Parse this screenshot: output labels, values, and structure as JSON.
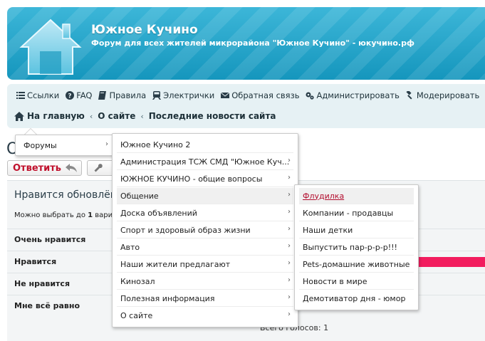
{
  "header": {
    "title": "Южное Кучино",
    "subtitle": "Форум для всех жителей микрорайона \"Южное Кучино\" - юкучино.рф"
  },
  "toplinks": [
    {
      "label": "Ссылки",
      "icon": "list-icon"
    },
    {
      "label": "FAQ",
      "icon": "question-circle-icon"
    },
    {
      "label": "Правила",
      "icon": "book-icon"
    },
    {
      "label": "Электрички",
      "icon": "train-icon"
    },
    {
      "label": "Обратная связь",
      "icon": "envelope-icon"
    },
    {
      "label": "Администрировать",
      "icon": "gears-icon"
    },
    {
      "label": "Модерировать",
      "icon": "gavel-icon"
    }
  ],
  "breadcrumb": {
    "home": "На главную",
    "items": [
      "О сайте",
      "Последние новости сайта"
    ]
  },
  "page": {
    "title_fragment": "О",
    "reply_label": "Ответить",
    "poll_title": "Нравится обновлён",
    "poll_hint_prefix": "Можно выбрать до ",
    "poll_hint_num": "1",
    "poll_hint_suffix": " вари",
    "poll_options": [
      "Очень нравится",
      "Нравится",
      "Не нравится",
      "Мне всё равно"
    ],
    "poll_bar_fraction": 1.0,
    "poll_total": "Всего голосов: 1",
    "colors": {
      "accent": "#c0102c",
      "bar": "#f21c5e",
      "header": "#1596bd"
    }
  },
  "menus": {
    "level1": [
      {
        "label": "Форумы",
        "submenu": true
      }
    ],
    "level2": [
      {
        "label": "Южное Кучино 2",
        "submenu": false
      },
      {
        "label": "Администрация ТСЖ СМД \"Южное Куч...",
        "submenu": true
      },
      {
        "label": "ЮЖНОЕ КУЧИНО - общие вопросы",
        "submenu": true
      },
      {
        "label": "Общение",
        "submenu": true,
        "highlighted": true
      },
      {
        "label": "Доска объявлений",
        "submenu": true
      },
      {
        "label": "Спорт и здоровый образ жизни",
        "submenu": true
      },
      {
        "label": "Авто",
        "submenu": true
      },
      {
        "label": "Наши жители предлагают",
        "submenu": true
      },
      {
        "label": "Кинозал",
        "submenu": true
      },
      {
        "label": "Полезная информация",
        "submenu": true
      },
      {
        "label": "О сайте",
        "submenu": true
      }
    ],
    "level3": [
      {
        "label": "Флудилка",
        "active": true
      },
      {
        "label": "Компании - продавцы"
      },
      {
        "label": "Наши детки"
      },
      {
        "label": "Выпустить пар-р-р-р!!!"
      },
      {
        "label": "Pets-домашние животные"
      },
      {
        "label": "Новости в мире"
      },
      {
        "label": "Демотиватор дня - юмор"
      }
    ]
  }
}
